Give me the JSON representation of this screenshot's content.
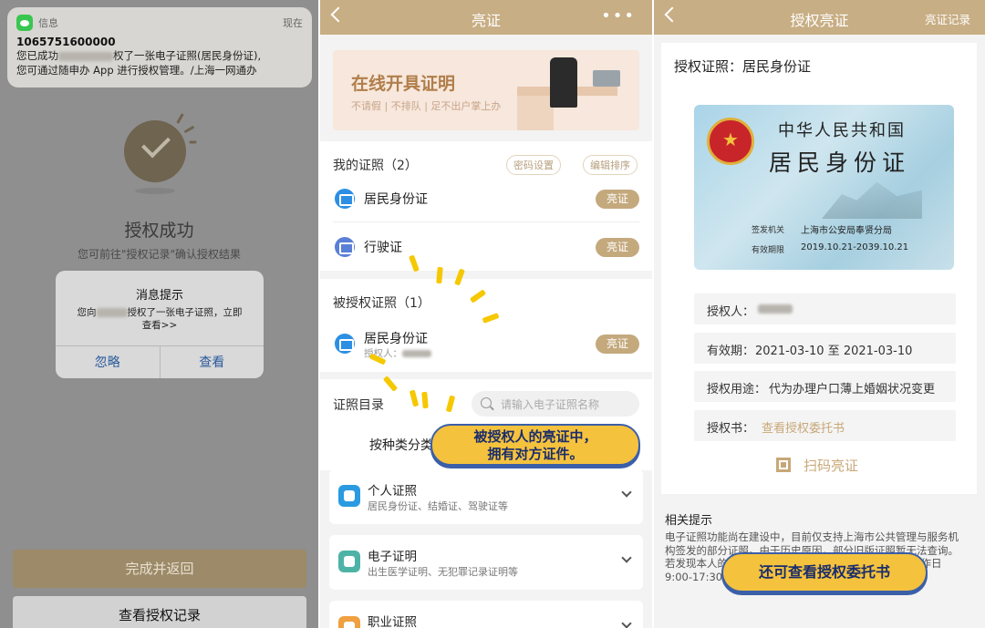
{
  "panel1": {
    "notification": {
      "app": "信息",
      "time": "现在",
      "sender": "1065751600000",
      "line1a": "您已成功",
      "line1b": "权了一张电子证照(居民身份证),",
      "line2": "您可通过随申办 App 进行授权管理。/上海一网通办"
    },
    "title": "授权成功",
    "subtitle": "您可前往\"授权记录\"确认授权结果",
    "dialog": {
      "title": "消息提示",
      "body_a": "您向",
      "body_b": "授权了一张电子证照，立即",
      "body_c": "查看>>",
      "ignore": "忽略",
      "view": "查看"
    },
    "done_button": "完成并返回",
    "records_button": "查看授权记录"
  },
  "panel2": {
    "title": "亮证",
    "more": "•••",
    "banner": {
      "title": "在线开具证明",
      "subtitle": "不请假 | 不排队 | 足不出户掌上办"
    },
    "my_certs": {
      "title": "我的证照（2）",
      "pwd": "密码设置",
      "sort": "编辑排序"
    },
    "my_items": [
      {
        "label": "居民身份证",
        "badge": "亮证"
      },
      {
        "label": "行驶证",
        "badge": "亮证"
      }
    ],
    "authorized": {
      "title": "被授权证照（1）",
      "label": "居民身份证",
      "sub": "授权人：",
      "badge": "亮证"
    },
    "catalog": {
      "title": "证照目录",
      "search_placeholder": "请输入电子证照名称",
      "tab": "按种类分类"
    },
    "categories": [
      {
        "title": "个人证照",
        "sub": "居民身份证、结婚证、驾驶证等"
      },
      {
        "title": "电子证明",
        "sub": "出生医学证明、无犯罪记录证明等"
      },
      {
        "title": "职业证照",
        "sub": ""
      }
    ],
    "callout": {
      "line1": "被授权人的亮证中，",
      "line2": "拥有对方证件。"
    }
  },
  "panel3": {
    "title": "授权亮证",
    "right_link": "亮证记录",
    "header": "授权证照：居民身份证",
    "idcard": {
      "country": "中华人民共和国",
      "doc": "居民身份证",
      "issuer_label": "签发机关",
      "issuer": "上海市公安局奉贤分局",
      "valid_label": "有效期限",
      "valid": "2019.10.21-2039.10.21"
    },
    "fields": {
      "grantor_k": "授权人：",
      "period_k": "有效期：",
      "period_v": "2021-03-10 至 2021-03-10",
      "use_k": "授权用途：",
      "use_v": "代为办理户口薄上婚姻状况变更",
      "letter_k": "授权书：",
      "letter_v": "查看授权委托书"
    },
    "scan": "扫码亮证",
    "tips_title": "相关提示",
    "tips_body_1": "电子证照功能尚在建设中，目前仅支持上海市公共管理与服务机",
    "tips_body_2": "构签发的部分证照。由于历史原因，部分旧版证照暂无法查询。",
    "tips_body_3": "若发现本人的",
    "tips_body_3b": "工作日",
    "tips_body_4": "9:00-17:30",
    "callout": "还可查看授权委托书"
  },
  "colors": {
    "gold": "#c8ae84",
    "badge": "#c4a97d",
    "callout": "#f5c23d",
    "callout_border": "#3b5fa8"
  }
}
